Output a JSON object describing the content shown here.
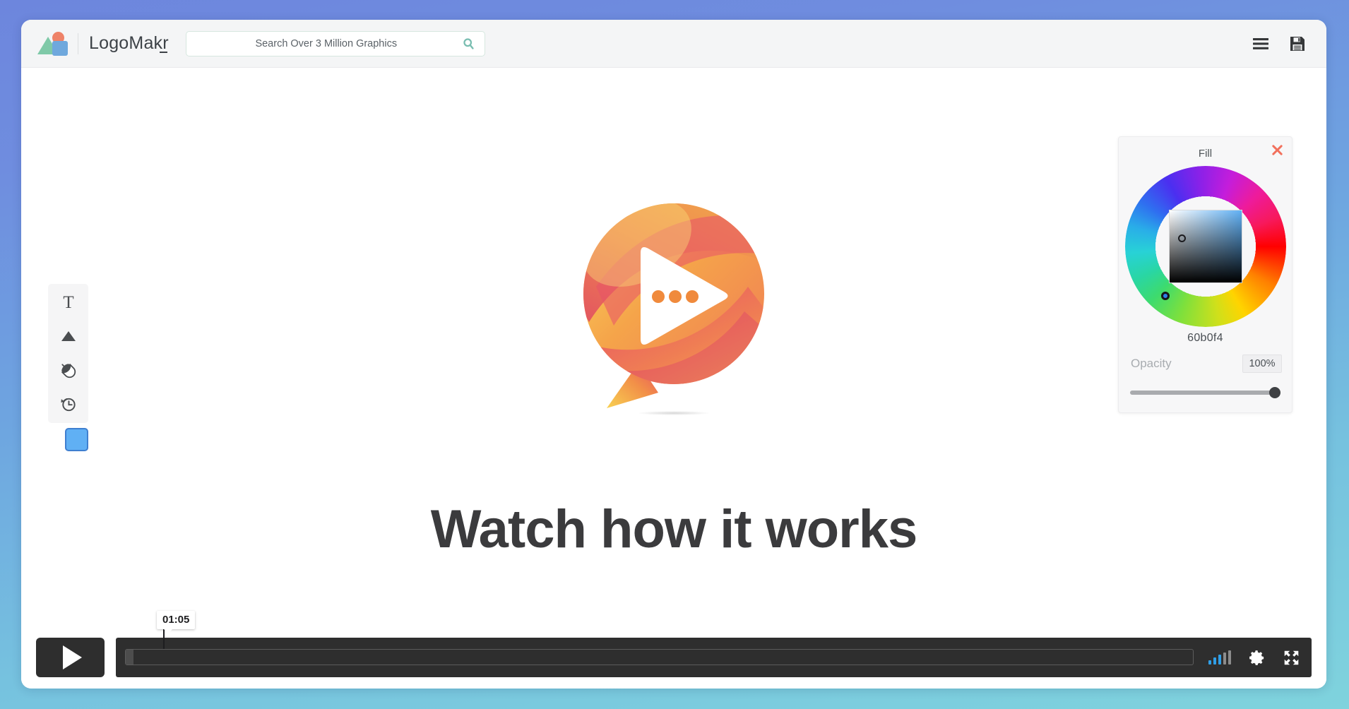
{
  "app": {
    "brand_name": "LogoMakr"
  },
  "header": {
    "search": {
      "placeholder": "Search Over 3 Million Graphics",
      "value": "",
      "icon": "search-icon"
    },
    "menu_icon": "hamburger-menu-icon",
    "save_icon": "save-floppy-disk-icon"
  },
  "toolbar": {
    "items": [
      {
        "name": "text-tool",
        "icon": "text-T-icon",
        "label": "T"
      },
      {
        "name": "shape-tool",
        "icon": "triangle-shape-icon",
        "label": "Shape"
      },
      {
        "name": "fill-tool",
        "icon": "paint-bucket-icon",
        "label": "Fill"
      },
      {
        "name": "history-tool",
        "icon": "clock-history-icon",
        "label": "History"
      }
    ],
    "swatch_color": "#60b0f4"
  },
  "canvas": {
    "headline": "Watch how it works",
    "artwork_name": "video-play-speech-bubble-logo",
    "artwork_colors": {
      "yellow": "#f9d14f",
      "orange": "#f2913f",
      "coral": "#ef6a52",
      "red": "#e34b5e",
      "magenta": "#d93b6b",
      "dot": "#f08a3c"
    }
  },
  "color_picker": {
    "title": "Fill",
    "close_icon": "close-x-icon",
    "hex": "60b0f4",
    "selected_color": "#60b0f4",
    "opacity_label": "Opacity",
    "opacity_value": "100%",
    "opacity_percent": 100
  },
  "player": {
    "play_icon": "play-triangle-icon",
    "time_label": "01:05",
    "progress_percent": 0.7,
    "volume_icon": "volume-bars-icon",
    "volume_active_bars": 3,
    "volume_total_bars": 5,
    "volume_active_color": "#2f9fe8",
    "volume_inactive_color": "#8c8c8c",
    "settings_icon": "gear-settings-icon",
    "fullscreen_icon": "fullscreen-expand-icon"
  }
}
